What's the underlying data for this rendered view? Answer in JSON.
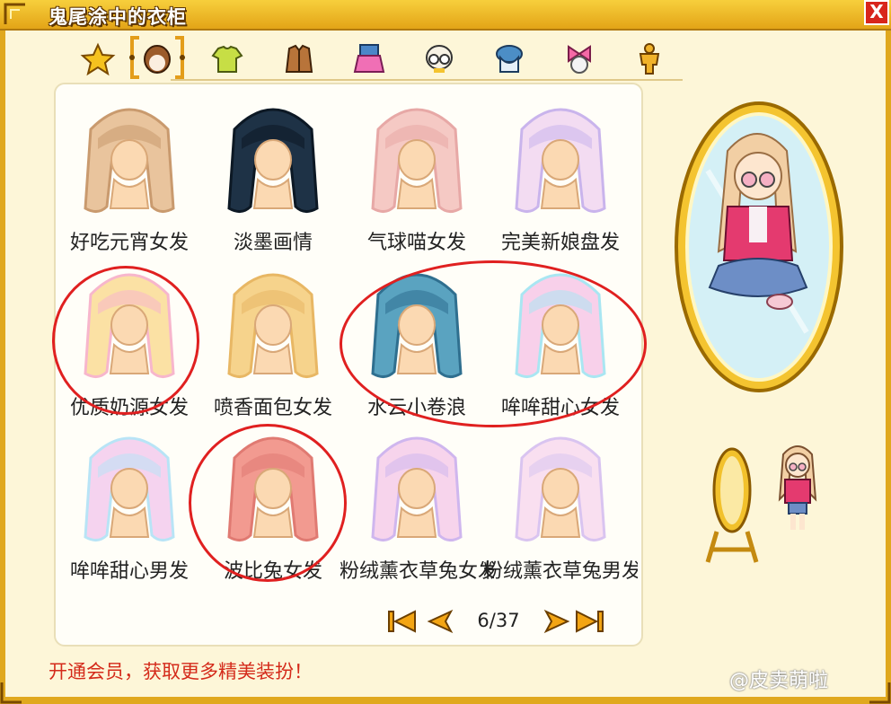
{
  "window": {
    "title": "鬼尾涂中的衣柜",
    "close_label": "X"
  },
  "tabs": [
    {
      "icon": "star-icon",
      "active": false
    },
    {
      "icon": "hair-icon",
      "active": true
    },
    {
      "icon": "shirt-icon",
      "active": false
    },
    {
      "icon": "jacket-icon",
      "active": false
    },
    {
      "icon": "skirt-icon",
      "active": false
    },
    {
      "icon": "glasses-icon",
      "active": false
    },
    {
      "icon": "hat-icon",
      "active": false
    },
    {
      "icon": "bow-icon",
      "active": false
    },
    {
      "icon": "full-outfit-icon",
      "active": false
    }
  ],
  "items": [
    {
      "label": "好吃元宵女发",
      "colors": [
        "#e9c49d",
        "#c99a6e"
      ],
      "circled": false
    },
    {
      "label": "淡墨画情",
      "colors": [
        "#1e3246",
        "#0c1824"
      ],
      "circled": false
    },
    {
      "label": "气球喵女发",
      "colors": [
        "#f5c9c4",
        "#e7a8a6"
      ],
      "circled": false
    },
    {
      "label": "完美新娘盘发",
      "colors": [
        "#f3dcf2",
        "#c9b4ec"
      ],
      "circled": false
    },
    {
      "label": "优质奶源女发",
      "colors": [
        "#fbe1a4",
        "#f7b6cc"
      ],
      "circled": true
    },
    {
      "label": "喷香面包女发",
      "colors": [
        "#f6d38c",
        "#e8b764"
      ],
      "circled": false
    },
    {
      "label": "水云小卷浪",
      "colors": [
        "#5aa3c0",
        "#2f6f8f"
      ],
      "circled": true
    },
    {
      "label": "哞哞甜心女发",
      "colors": [
        "#f8d0ea",
        "#a9e6f2"
      ],
      "circled": true
    },
    {
      "label": "哞哞甜心男发",
      "colors": [
        "#f5d3ef",
        "#b8e4f6"
      ],
      "circled": false
    },
    {
      "label": "波比兔女发",
      "colors": [
        "#f29a90",
        "#e07a72"
      ],
      "circled": true
    },
    {
      "label": "粉绒薰衣草兔女发",
      "colors": [
        "#f7d4ec",
        "#cfb6ee"
      ],
      "circled": false
    },
    {
      "label": "粉绒薰衣草兔男发",
      "colors": [
        "#f9dff0",
        "#d9c4f0"
      ],
      "circled": false
    }
  ],
  "pager": {
    "page_text": "6/37",
    "current": 6,
    "total": 37
  },
  "footer": {
    "member_promo": "开通会员，获取更多精美装扮！",
    "watermark": "@皮卖萌啦"
  },
  "colors": {
    "frame": "#e0a81e",
    "panel_bg": "#fffef8",
    "promo_red": "#d42a1a",
    "circle_red": "#e02020"
  }
}
